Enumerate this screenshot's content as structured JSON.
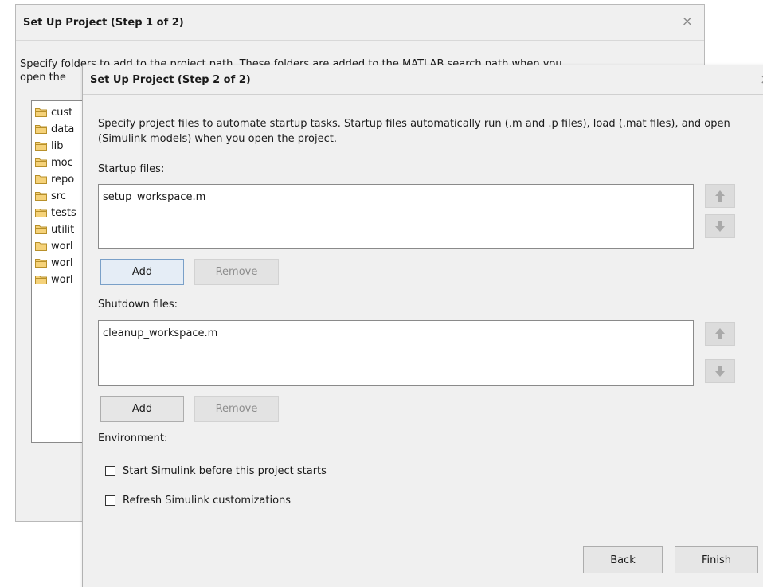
{
  "step1": {
    "title": "Set Up Project (Step 1 of 2)",
    "description_line1": "Specify folders to add to the project path. These folders are added to the MATLAB search path when you",
    "description_line2": "open the",
    "folders": [
      "cust",
      "data",
      "lib",
      "moc",
      "repo",
      "src",
      "tests",
      "utilit",
      "worl",
      "worl",
      "worl"
    ]
  },
  "step2": {
    "title": "Set Up Project (Step 2 of 2)",
    "description": "Specify project files to automate startup tasks. Startup files automatically run (.m and .p files), load (.mat files), and open (Simulink models) when you open the project.",
    "startup_label": "Startup files:",
    "startup_files": [
      "setup_workspace.m"
    ],
    "shutdown_label": "Shutdown files:",
    "shutdown_files": [
      "cleanup_workspace.m"
    ],
    "add_label": "Add",
    "remove_label": "Remove",
    "environment_label": "Environment:",
    "options": [
      {
        "label": "Start Simulink before this project starts",
        "checked": false
      },
      {
        "label": "Refresh Simulink customizations",
        "checked": false
      }
    ],
    "back_label": "Back",
    "finish_label": "Finish"
  },
  "colors": {
    "folder_fill": "#f5d27a",
    "folder_stroke": "#b8902a",
    "arrow_fill": "#a9a9a9"
  },
  "icons": {
    "close": "×",
    "folder": "folder-icon",
    "move_up": "arrow-up-icon",
    "move_down": "arrow-down-icon"
  }
}
